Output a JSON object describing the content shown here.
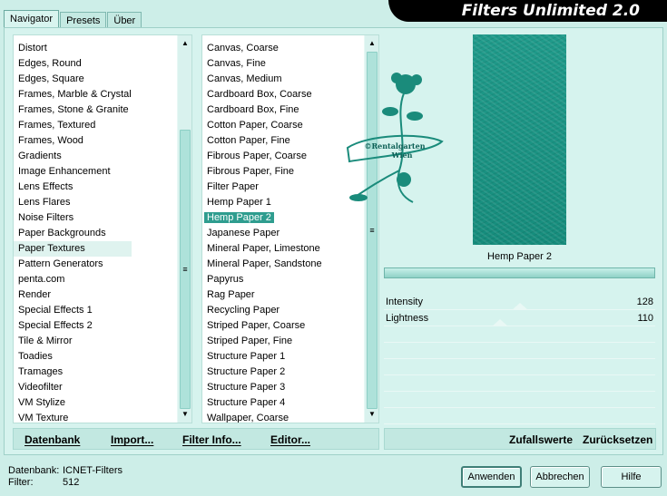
{
  "title": "Filters Unlimited 2.0",
  "tabs": [
    "Navigator",
    "Presets",
    "Über"
  ],
  "categories": [
    "Distort",
    "Edges, Round",
    "Edges, Square",
    "Frames, Marble & Crystal",
    "Frames, Stone & Granite",
    "Frames, Textured",
    "Frames, Wood",
    "Gradients",
    "Image Enhancement",
    "Lens Effects",
    "Lens Flares",
    "Noise Filters",
    "Paper Backgrounds",
    "Paper Textures",
    "Pattern Generators",
    "penta.com",
    "Render",
    "Special Effects 1",
    "Special Effects 2",
    "Tile & Mirror",
    "Toadies",
    "Tramages",
    "Videofilter",
    "VM Stylize",
    "VM Texture"
  ],
  "selected_category": "Paper Textures",
  "filters": [
    "Canvas, Coarse",
    "Canvas, Fine",
    "Canvas, Medium",
    "Cardboard Box, Coarse",
    "Cardboard Box, Fine",
    "Cotton Paper, Coarse",
    "Cotton Paper, Fine",
    "Fibrous Paper, Coarse",
    "Fibrous Paper, Fine",
    "Filter Paper",
    "Hemp Paper 1",
    "Hemp Paper 2",
    "Japanese Paper",
    "Mineral Paper, Limestone",
    "Mineral Paper, Sandstone",
    "Papyrus",
    "Rag Paper",
    "Recycling Paper",
    "Striped Paper, Coarse",
    "Striped Paper, Fine",
    "Structure Paper 1",
    "Structure Paper 2",
    "Structure Paper 3",
    "Structure Paper 4",
    "Wallpaper, Coarse"
  ],
  "selected_filter": "Hemp Paper 2",
  "preview": {
    "filter_name": "Hemp Paper 2",
    "watermark_lines": [
      "©Rentalgarten",
      "Wien"
    ]
  },
  "sliders": [
    {
      "label": "Intensity",
      "value": 128
    },
    {
      "label": "Lightness",
      "value": 110
    }
  ],
  "progress": 1.0,
  "left_buttons": [
    "Datenbank",
    "Import...",
    "Filter Info...",
    "Editor..."
  ],
  "right_buttons": [
    "Zufallswerte",
    "Zurücksetzen"
  ],
  "status": {
    "db_label": "Datenbank:",
    "db_value": "ICNET-Filters",
    "filter_label": "Filter:",
    "filter_value": "512"
  },
  "actions": [
    "Anwenden",
    "Abbrechen",
    "Hilfe"
  ],
  "colors": {
    "background": "#cdeee8",
    "accent": "#2f9d8f",
    "texture": "#1f9a8a",
    "banner": "#000000"
  }
}
